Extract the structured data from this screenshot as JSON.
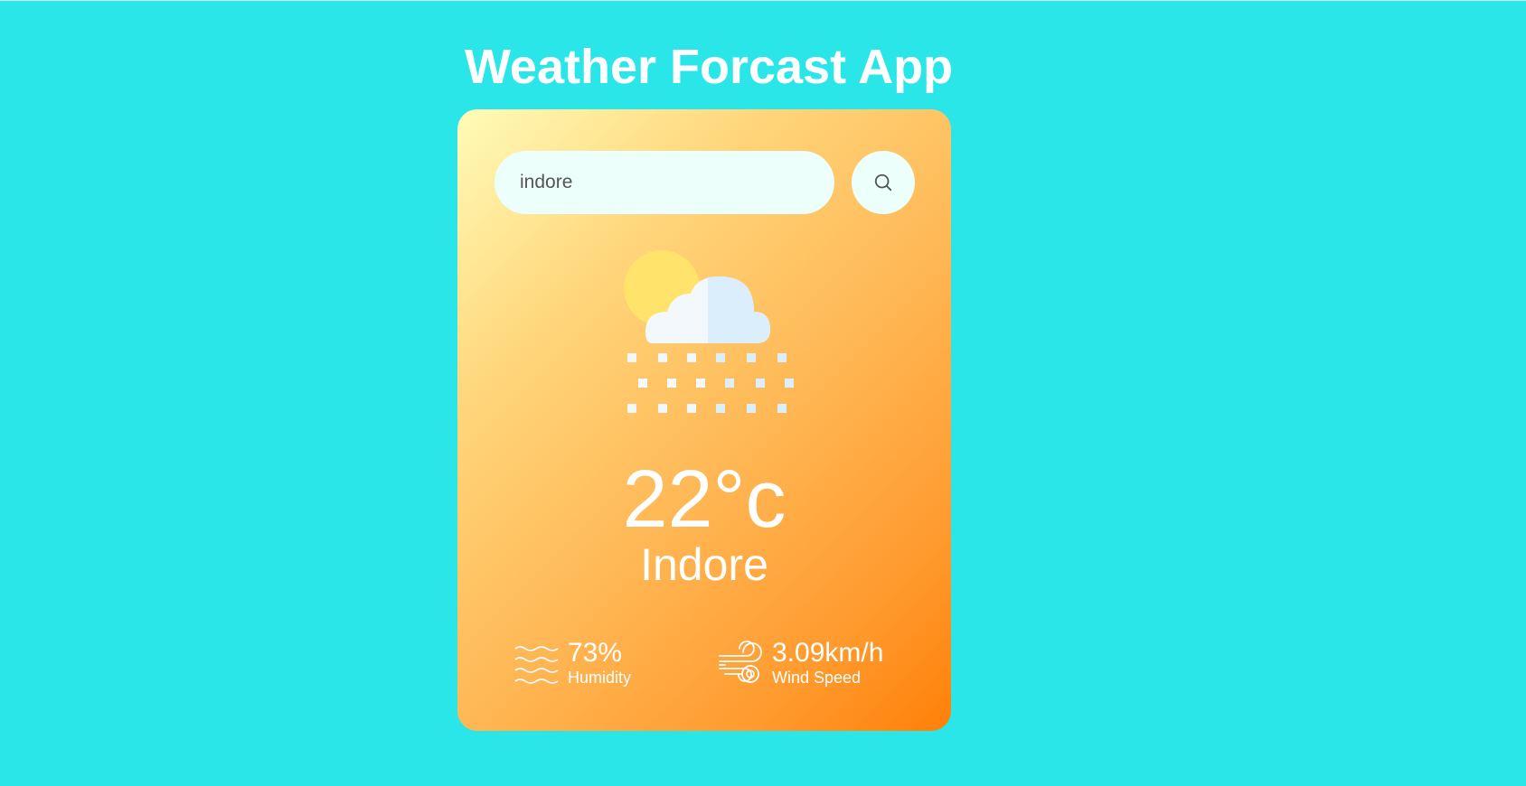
{
  "app": {
    "title": "Weather Forcast App"
  },
  "search": {
    "value": "indore",
    "icon": "search-icon"
  },
  "weather": {
    "icon": "snow-cloud-sun-icon",
    "temperature": "22°c",
    "city": "Indore"
  },
  "details": {
    "humidity": {
      "icon": "humidity-waves-icon",
      "value": "73%",
      "label": "Humidity"
    },
    "wind": {
      "icon": "wind-icon",
      "value": "3.09km/h",
      "label": "Wind Speed"
    }
  },
  "colors": {
    "background": "#2ae6e8",
    "card_gradient_start": "#fffcb8",
    "card_gradient_end": "#ff8008",
    "input_background": "#ecfffb",
    "text": "#ffffff"
  }
}
